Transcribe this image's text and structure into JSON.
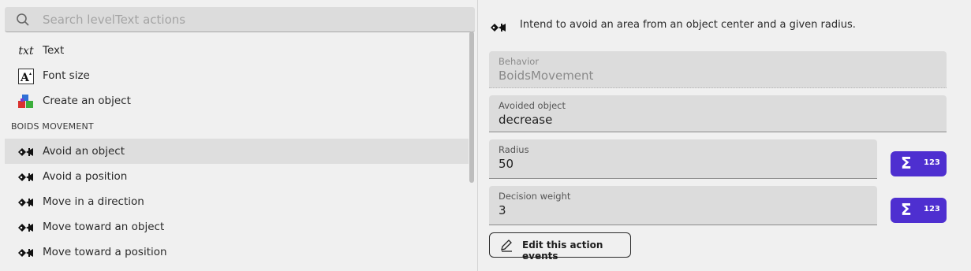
{
  "search": {
    "placeholder": "Search levelText actions",
    "icon": "search-icon"
  },
  "list": {
    "items_top": [
      {
        "label": "Text",
        "icon": "text-italic-icon"
      },
      {
        "label": "Font size",
        "icon": "font-size-icon"
      },
      {
        "label": "Create an object",
        "icon": "cubes-icon"
      }
    ],
    "section_title": "BOIDS MOVEMENT",
    "items_boids": [
      {
        "label": "Avoid an object",
        "icon": "fish-icon",
        "selected": true
      },
      {
        "label": "Avoid a position",
        "icon": "fish-icon"
      },
      {
        "label": "Move in a direction",
        "icon": "fish-icon"
      },
      {
        "label": "Move toward an object",
        "icon": "fish-icon"
      },
      {
        "label": "Move toward a position",
        "icon": "fish-icon"
      }
    ]
  },
  "details": {
    "description": "Intend to avoid an area from an object center and a given radius.",
    "fields": {
      "behavior": {
        "label": "Behavior",
        "value": "BoidsMovement"
      },
      "avoided_object": {
        "label": "Avoided object",
        "value": "decrease"
      },
      "radius": {
        "label": "Radius",
        "value": "50"
      },
      "decision_weight": {
        "label": "Decision weight",
        "value": "3"
      }
    },
    "expression_button": {
      "sigma": "Σ",
      "num": "123"
    },
    "edit_button": "Edit this action events"
  },
  "colors": {
    "accent": "#4e2fd0",
    "selected_bg": "#dedede",
    "field_bg": "#dcdcdc"
  }
}
